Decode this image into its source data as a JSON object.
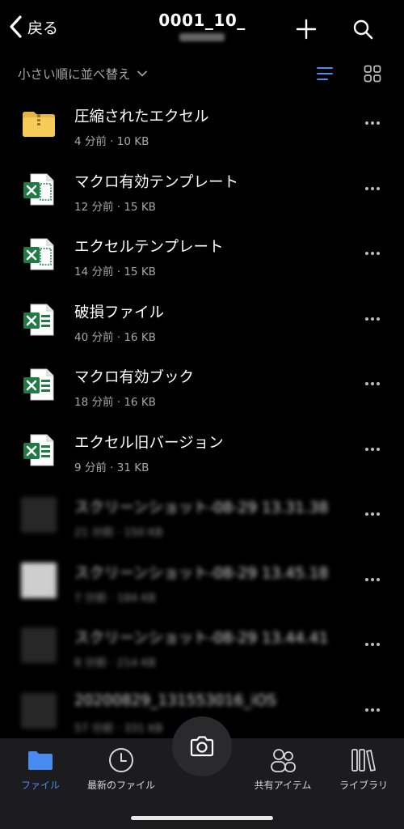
{
  "header": {
    "back_label": "戻る",
    "title": "0001_10_",
    "subtitle": ""
  },
  "icons": {
    "back": "chevron-left-icon",
    "add": "plus-icon",
    "search": "search-icon",
    "sort": "chevron-down-icon",
    "list_view": "list-view-icon",
    "grid_view": "grid-view-icon",
    "camera": "camera-icon",
    "more": "more-horizontal-icon"
  },
  "sort": {
    "label": "小さい順に並べ替え"
  },
  "colors": {
    "accent": "#4a8bf2",
    "excel": "#1f7a44",
    "folder": "#f1c14e"
  },
  "files": [
    {
      "name": "圧縮されたエクセル",
      "meta": "4 分前 · 10 KB",
      "type": "zip-folder"
    },
    {
      "name": "マクロ有効テンプレート",
      "meta": "12 分前 · 15 KB",
      "type": "excel-template"
    },
    {
      "name": "エクセルテンプレート",
      "meta": "14 分前 · 15 KB",
      "type": "excel-template"
    },
    {
      "name": "破損ファイル",
      "meta": "40 分前 · 16 KB",
      "type": "excel"
    },
    {
      "name": "マクロ有効ブック",
      "meta": "18 分前 · 16 KB",
      "type": "excel"
    },
    {
      "name": "エクセル旧バージョン",
      "meta": "9 分前 · 31 KB",
      "type": "excel"
    },
    {
      "name": "スクリーンショット-08-29 13.31.38",
      "meta": "21 分前 · 150 KB",
      "type": "image-dark"
    },
    {
      "name": "スクリーンショット-08-29 13.45.18",
      "meta": "7 分前 · 184 KB",
      "type": "image-light"
    },
    {
      "name": "スクリーンショット-08-29 13.44.41",
      "meta": "8 分前 · 214 KB",
      "type": "image-dark"
    },
    {
      "name": "20200829_131553016_iOS",
      "meta": "57 分前 · 331 KB",
      "type": "image-dark"
    }
  ],
  "tabs": [
    {
      "label": "ファイル",
      "icon": "folder-icon",
      "active": true
    },
    {
      "label": "最新のファイル",
      "icon": "clock-icon",
      "active": false
    },
    {
      "label": "共有アイテム",
      "icon": "people-icon",
      "active": false
    },
    {
      "label": "ライブラリ",
      "icon": "library-icon",
      "active": false
    }
  ]
}
